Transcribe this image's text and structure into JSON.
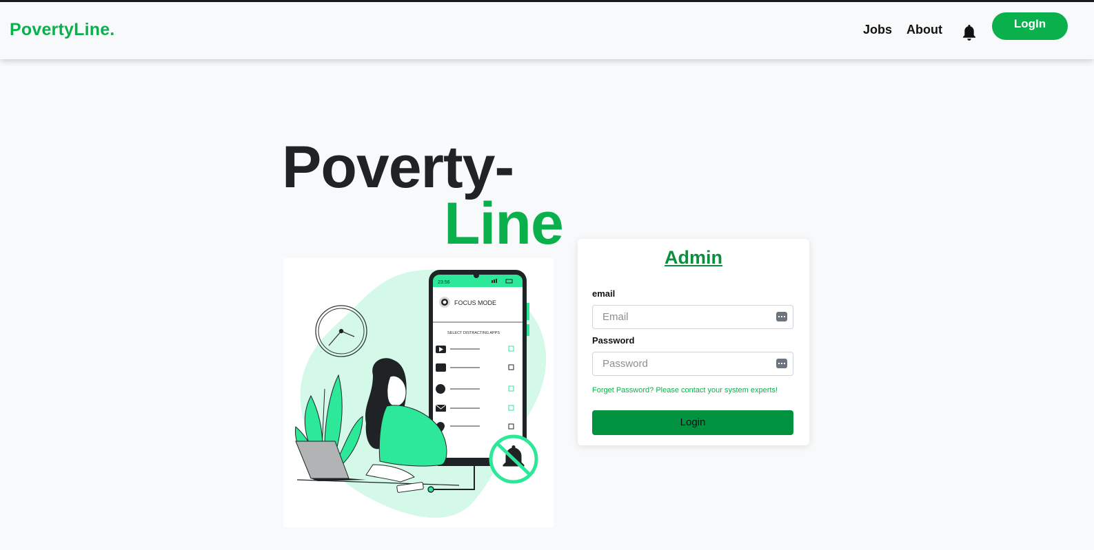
{
  "navbar": {
    "brand": "PovertyLine.",
    "links": [
      "Jobs",
      "About"
    ],
    "notification_icon": "bell-icon",
    "login_button": "LogIn"
  },
  "hero": {
    "title_line1": "Poverty-",
    "title_line2": "Line",
    "illustration": {
      "phone_time": "23:56",
      "phone_header": "FOCUS MODE",
      "phone_subheader": "SELECT DISTRACTING APPS"
    }
  },
  "login_card": {
    "title": "Admin",
    "email_label": "email",
    "email_placeholder": "Email",
    "password_label": "Password",
    "password_placeholder": "Password",
    "forgot_text": "Forget Password? Please contact your system experts!",
    "submit_label": "Login"
  },
  "colors": {
    "accent": "#0ab04c",
    "accent_dark": "#00923f",
    "title_dark": "#1f2326",
    "illustration_mint": "#2ee89a"
  }
}
